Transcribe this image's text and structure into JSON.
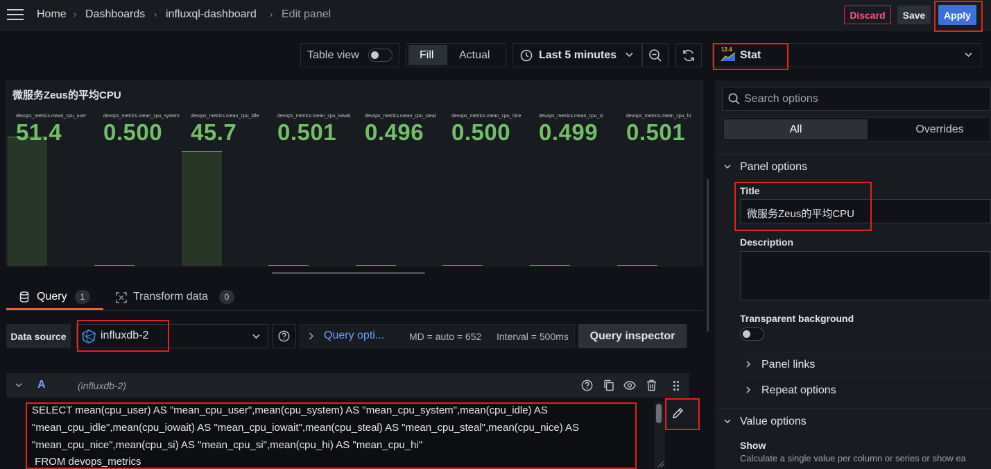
{
  "breadcrumb": {
    "home": "Home",
    "dashboards": "Dashboards",
    "dashboard": "influxql-dashboard",
    "current": "Edit panel"
  },
  "actions": {
    "discard": "Discard",
    "save": "Save",
    "apply": "Apply"
  },
  "toolbar": {
    "table_view": "Table view",
    "table_view_on": false,
    "fill": "Fill",
    "actual": "Actual",
    "time_range": "Last 5 minutes"
  },
  "visualization": {
    "icon_badge": "12.4",
    "name": "Stat"
  },
  "panel": {
    "title": "微服务Zeus的平均CPU",
    "stats": [
      {
        "label": "devops_metrics.mean_cpu_user",
        "value": "51.4"
      },
      {
        "label": "devops_metrics.mean_cpu_system",
        "value": "0.500"
      },
      {
        "label": "devops_metrics.mean_cpu_idle",
        "value": "45.7"
      },
      {
        "label": "devops_metrics.mean_cpu_iowait",
        "value": "0.501"
      },
      {
        "label": "devops_metrics.mean_cpu_steal",
        "value": "0.496"
      },
      {
        "label": "devops_metrics.mean_cpu_nice",
        "value": "0.500"
      },
      {
        "label": "devops_metrics.mean_cpu_si",
        "value": "0.499"
      },
      {
        "label": "devops_metrics.mean_cpu_hi",
        "value": "0.501"
      }
    ],
    "value_color": "#73bf69"
  },
  "tabs": [
    {
      "label": "Query",
      "count": "1"
    },
    {
      "label": "Transform data",
      "count": "0"
    }
  ],
  "query": {
    "datasource_label": "Data source",
    "datasource": "influxdb-2",
    "options_label": "Query opti...",
    "md": "MD = auto = 652",
    "interval": "Interval = 500ms",
    "inspector": "Query inspector",
    "ref_id": "A",
    "ref_source": "(influxdb-2)",
    "sql_lines": [
      "SELECT mean(cpu_user) AS \"mean_cpu_user\",mean(cpu_system) AS \"mean_cpu_system\",mean(cpu_idle) AS",
      "\"mean_cpu_idle\",mean(cpu_iowait) AS \"mean_cpu_iowait\",mean(cpu_steal) AS \"mean_cpu_steal\",mean(cpu_nice) AS",
      "\"mean_cpu_nice\",mean(cpu_si) AS \"mean_cpu_si\",mean(cpu_hi) AS \"mean_cpu_hi\"",
      " FROM devops_metrics"
    ]
  },
  "options": {
    "search_placeholder": "Search options",
    "tab_all": "All",
    "tab_overrides": "Overrides",
    "panel_options": "Panel options",
    "title_label": "Title",
    "title_value": "微服务Zeus的平均CPU",
    "description_label": "Description",
    "transparent_label": "Transparent background",
    "transparent_on": false,
    "panel_links": "Panel links",
    "repeat_options": "Repeat options",
    "value_options": "Value options",
    "show_label": "Show",
    "show_desc": "Calculate a single value per column or series or show ea"
  },
  "colors": {
    "accent": "#3d71d9",
    "discard": "#ff5286",
    "highlight": "#e2231a"
  }
}
